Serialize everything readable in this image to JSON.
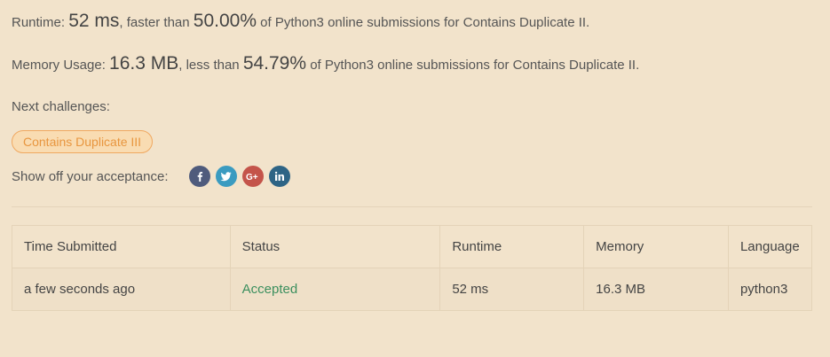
{
  "result": {
    "runtime": {
      "prefix": "Runtime: ",
      "value": "52 ms",
      "mid": ", faster than ",
      "percent": "50.00%",
      "suffix": " of Python3 online submissions for Contains Duplicate II."
    },
    "memory": {
      "prefix": "Memory Usage: ",
      "value": "16.3 MB",
      "mid": ", less than ",
      "percent": "54.79%",
      "suffix": " of Python3 online submissions for Contains Duplicate II."
    }
  },
  "next_challenges": {
    "label": "Next challenges:",
    "items": [
      {
        "label": "Contains Duplicate III"
      }
    ]
  },
  "share": {
    "label": "Show off your acceptance:",
    "buttons": [
      {
        "name": "facebook-icon",
        "color": "#4f5b7c"
      },
      {
        "name": "twitter-icon",
        "color": "#3b9bc0"
      },
      {
        "name": "google-plus-icon",
        "color": "#c4544a"
      },
      {
        "name": "linkedin-icon",
        "color": "#2e6485"
      }
    ]
  },
  "submissions": {
    "headers": [
      "Time Submitted",
      "Status",
      "Runtime",
      "Memory",
      "Language"
    ],
    "rows": [
      {
        "time": "a few seconds ago",
        "status": "Accepted",
        "runtime": "52 ms",
        "memory": "16.3 MB",
        "language": "python3"
      }
    ],
    "status_color": "#3b8f5e"
  }
}
